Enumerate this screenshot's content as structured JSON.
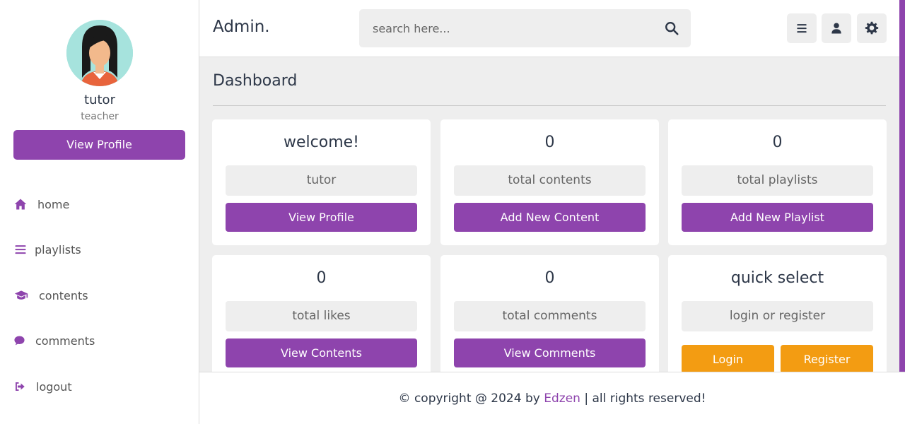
{
  "profile": {
    "name": "tutor",
    "role": "teacher",
    "view_profile_label": "View Profile"
  },
  "sidebar": {
    "items": [
      {
        "label": "home",
        "icon": "home-icon"
      },
      {
        "label": "playlists",
        "icon": "list-icon"
      },
      {
        "label": "contents",
        "icon": "graduation-cap-icon"
      },
      {
        "label": "comments",
        "icon": "comment-icon"
      },
      {
        "label": "logout",
        "icon": "logout-icon"
      }
    ]
  },
  "header": {
    "logo": "Admin.",
    "search_placeholder": "search here...",
    "icons": [
      "menu-icon",
      "user-icon",
      "gear-icon"
    ]
  },
  "main": {
    "title": "Dashboard",
    "cards": [
      {
        "title": "welcome!",
        "subtitle": "tutor",
        "button": "View Profile"
      },
      {
        "title": "0",
        "subtitle": "total contents",
        "button": "Add New Content"
      },
      {
        "title": "0",
        "subtitle": "total playlists",
        "button": "Add New Playlist"
      },
      {
        "title": "0",
        "subtitle": "total likes",
        "button": "View Contents"
      },
      {
        "title": "0",
        "subtitle": "total comments",
        "button": "View Comments"
      },
      {
        "title": "quick select",
        "subtitle": "login or register",
        "buttons": [
          "Login",
          "Register"
        ]
      }
    ]
  },
  "footer": {
    "prefix": "© copyright @ 2024 by ",
    "brand": "Edzen",
    "suffix": " | all rights reserved!"
  },
  "colors": {
    "accent": "#8e44ad",
    "orange": "#f39c12",
    "background": "#eeeeee"
  }
}
